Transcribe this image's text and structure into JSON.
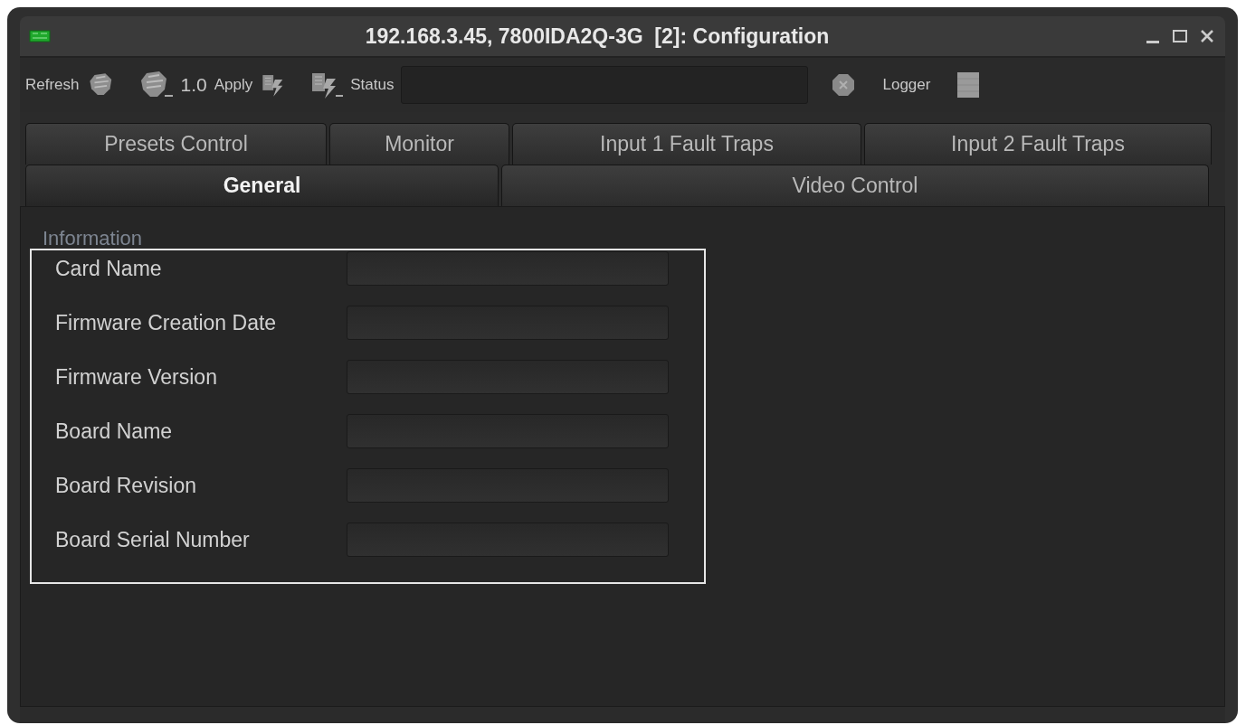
{
  "window": {
    "title": "192.168.3.45, 7800IDA2Q-3G  [2]: Configuration"
  },
  "toolbar": {
    "refresh_label": "Refresh",
    "version": "1.0",
    "apply_label": "Apply",
    "status_label": "Status",
    "logger_label": "Logger"
  },
  "tab_rows": [
    [
      {
        "label": "Presets Control",
        "selected": false
      },
      {
        "label": "Monitor",
        "selected": false
      },
      {
        "label": "Input 1 Fault Traps",
        "selected": false
      },
      {
        "label": "Input 2 Fault Traps",
        "selected": false
      }
    ],
    [
      {
        "label": "General",
        "selected": true
      },
      {
        "label": "Video Control",
        "selected": false
      }
    ]
  ],
  "information": {
    "title": "Information",
    "fields": [
      {
        "label": "Card Name"
      },
      {
        "label": "Firmware Creation Date"
      },
      {
        "label": "Firmware Version"
      },
      {
        "label": "Board Name"
      },
      {
        "label": "Board Revision"
      },
      {
        "label": "Board Serial Number"
      }
    ]
  }
}
